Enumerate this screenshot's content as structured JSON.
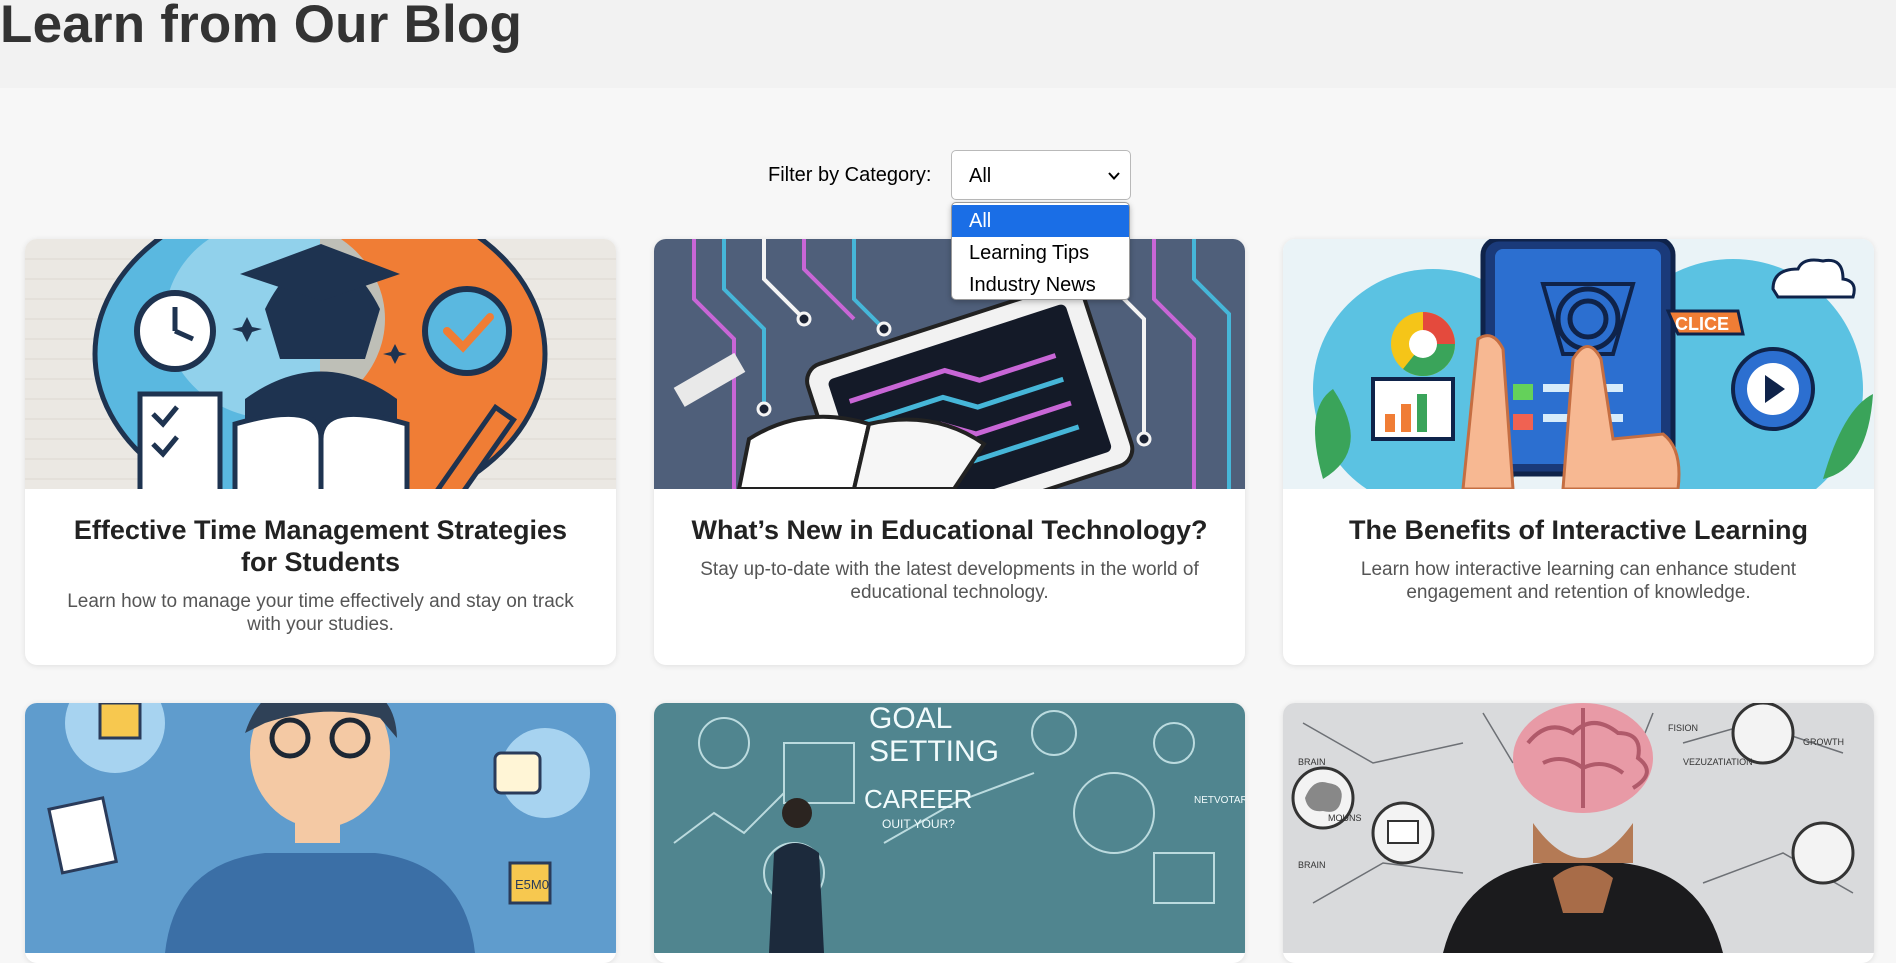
{
  "header": {
    "title": "Learn from Our Blog"
  },
  "filter": {
    "label": "Filter by Category:",
    "selected": "All",
    "options": [
      "All",
      "Learning Tips",
      "Industry News"
    ]
  },
  "posts": [
    {
      "title": "Effective Time Management Strategies for Students",
      "description": "Learn how to manage your time effectively and stay on track with your studies."
    },
    {
      "title": "What’s New in Educational Technology?",
      "description": "Stay up-to-date with the latest developments in the world of educational technology."
    },
    {
      "title": "The Benefits of Interactive Learning",
      "description": "Learn how interactive learning can enhance student engagement and retention of knowledge."
    },
    {
      "title": "",
      "description": ""
    },
    {
      "title": "",
      "description": ""
    },
    {
      "title": "",
      "description": ""
    }
  ],
  "image_text": {
    "click": "CLICE",
    "goal": "GOAL",
    "setting": "SETTING",
    "career": "CAREER",
    "career_sub": "OUIT YOUR?",
    "note": "E5M0",
    "brain": "BRAIN",
    "mounds": "MOUNS",
    "visualization": "VEZUZATIATION",
    "growth": "GROWTH",
    "brain2": "BRAIN",
    "fision": "FISION",
    "network": "NETVOTARO"
  },
  "colors": {
    "accent": "#1a6ee6",
    "title": "#333333",
    "card_bg": "#ffffff"
  }
}
